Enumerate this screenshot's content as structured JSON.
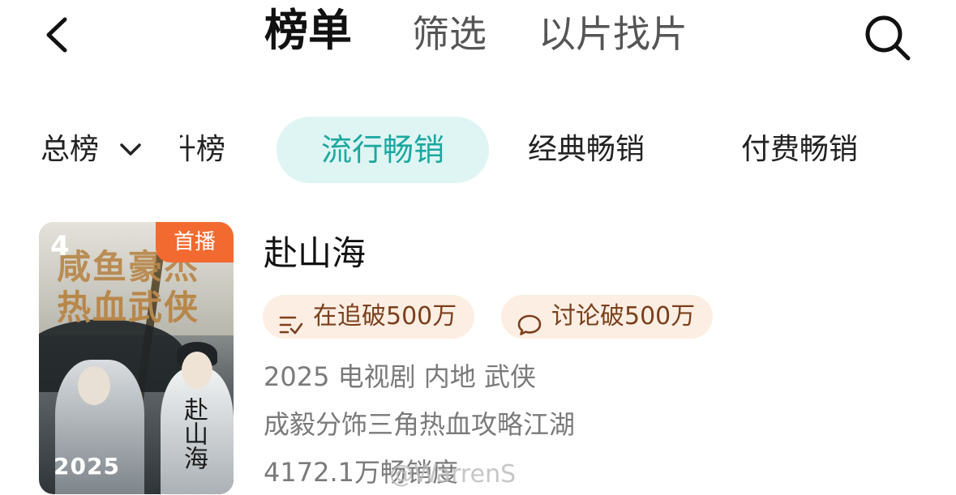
{
  "header": {
    "tabs": [
      {
        "label": "榜单",
        "active": true
      },
      {
        "label": "筛选",
        "active": false
      },
      {
        "label": "以片找片",
        "active": false
      }
    ]
  },
  "subtabs": {
    "items": [
      {
        "label": "总榜"
      },
      {
        "label": "升榜"
      },
      {
        "label": "流行畅销",
        "active": true
      },
      {
        "label": "经典畅销"
      },
      {
        "label": "付费畅销"
      }
    ]
  },
  "item": {
    "rank": "4",
    "badge": "首播",
    "poster_title_line1": "咸鱼豪杰",
    "poster_title_line2": "热血武侠",
    "poster_calligraphy": "赴山海",
    "poster_year": "2025",
    "title": "赴山海",
    "tags": [
      {
        "icon": "follow-list-icon",
        "label": "在追破500万"
      },
      {
        "icon": "comment-bubble-icon",
        "label": "讨论破500万"
      }
    ],
    "meta_line": "2025 电视剧 内地 武侠",
    "description": "成毅分饰三角热血攻略江湖",
    "sales": "4172.1万畅销度"
  },
  "watermark": "@WarrenS",
  "colors": {
    "accent_teal": "#1aa8a0",
    "pill_bg": "#dff5f3",
    "badge_orange": "#f26a30",
    "tag_bg": "#fdeee3",
    "tag_text": "#7b3f1c"
  }
}
